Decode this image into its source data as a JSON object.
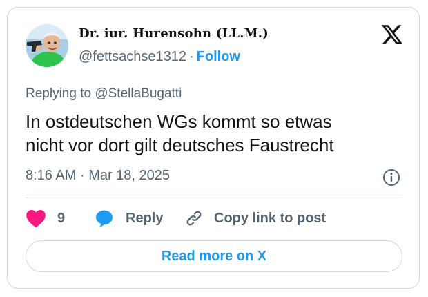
{
  "author": {
    "display_name": "Dr. iur. Hurensohn (LL.M.)",
    "handle": "@fettsachse1312",
    "separator": "·",
    "follow_label": "Follow"
  },
  "tweet": {
    "reply_prefix": "Replying to",
    "reply_to_handle": "@StellaBugatti",
    "text_line1": "In ostdeutschen WGs kommt so etwas",
    "text_line2": "nicht vor dort gilt deutsches Faustrecht",
    "time": "8:16 AM",
    "meta_separator": "·",
    "date": "Mar 18, 2025"
  },
  "actions": {
    "like_count": "9",
    "reply_label": "Reply",
    "copy_link_label": "Copy link to post"
  },
  "footer": {
    "read_more_label": "Read more on X"
  },
  "icons": {
    "logo": "x-logo-icon",
    "info": "info-icon",
    "like": "heart-icon",
    "reply": "speech-bubble-icon",
    "copy": "link-icon"
  },
  "colors": {
    "accent": "#1d9bf0",
    "like": "#f91880",
    "muted": "#536471",
    "text": "#0f1419",
    "border": "#cfd9de"
  }
}
